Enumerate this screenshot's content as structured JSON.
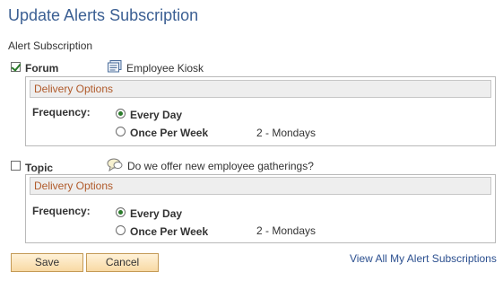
{
  "page": {
    "title": "Update Alerts Subscription",
    "section_label": "Alert Subscription"
  },
  "subscriptions": [
    {
      "type_label": "Forum",
      "checked": true,
      "icon": "forum-icon",
      "item_text": "Employee Kiosk",
      "delivery_header": "Delivery Options",
      "frequency_label": "Frequency:",
      "options": [
        {
          "label": "Every Day",
          "selected": true
        },
        {
          "label": "Once Per Week",
          "selected": false
        }
      ],
      "week_day": "2 - Mondays"
    },
    {
      "type_label": "Topic",
      "checked": false,
      "icon": "speech-bubble-icon",
      "item_text": "Do we offer new employee gatherings?",
      "delivery_header": "Delivery Options",
      "frequency_label": "Frequency:",
      "options": [
        {
          "label": "Every Day",
          "selected": true
        },
        {
          "label": "Once Per Week",
          "selected": false
        }
      ],
      "week_day": "2 - Mondays"
    }
  ],
  "buttons": {
    "save": "Save",
    "cancel": "Cancel"
  },
  "links": {
    "view_all": "View All My Alert Subscriptions"
  },
  "colors": {
    "title": "#3b5f93",
    "delivery_header_text": "#b05a2a",
    "check_and_radio": "#2a7a2a",
    "button_border": "#c49a56",
    "link": "#2b4f8f"
  }
}
